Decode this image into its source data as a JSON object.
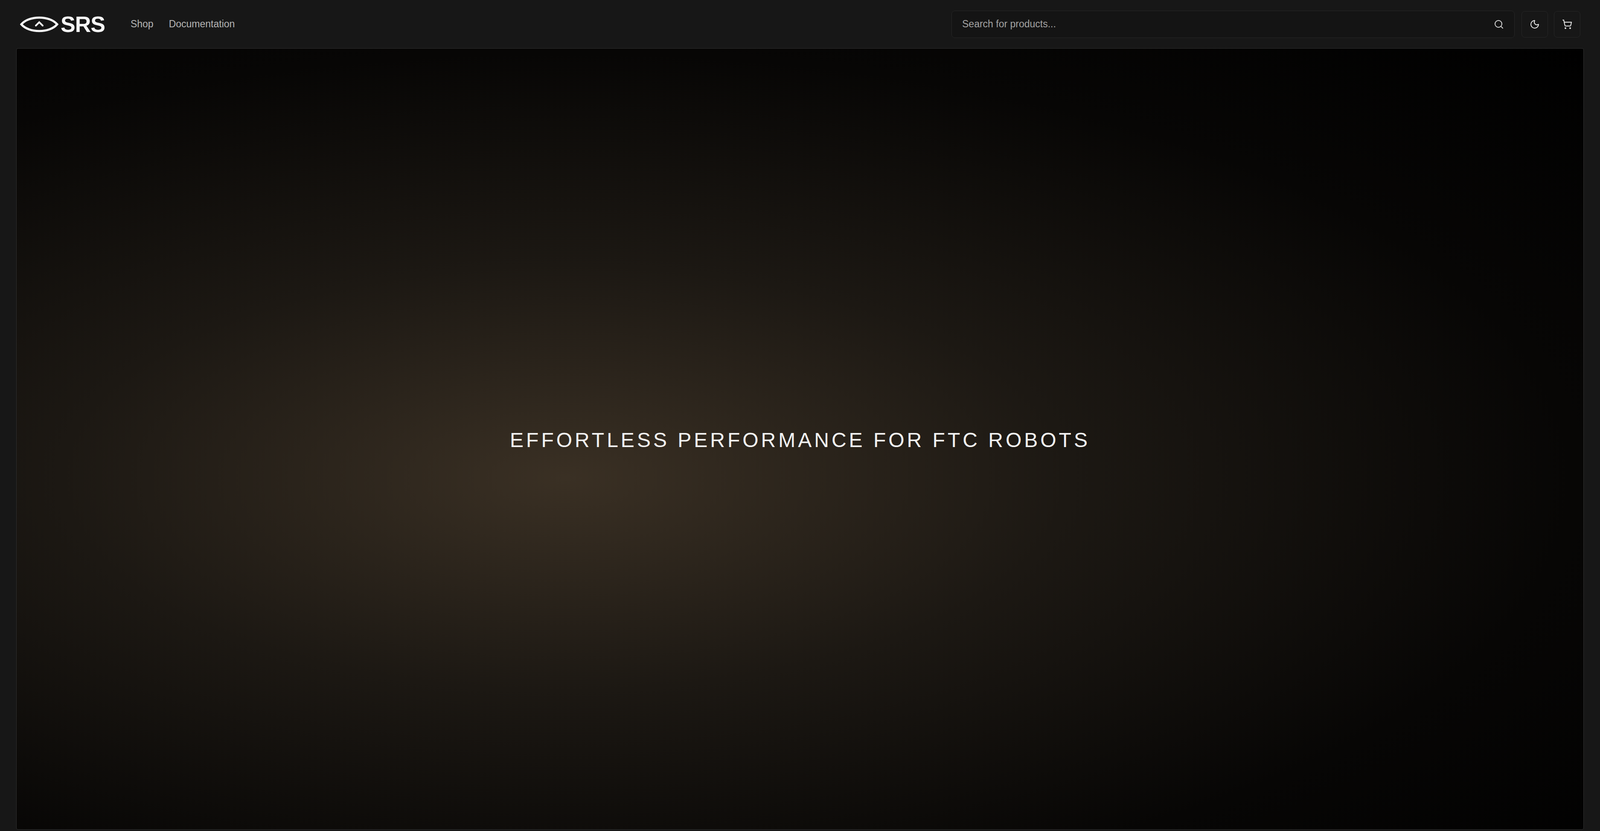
{
  "header": {
    "logo": "SRS",
    "nav": [
      {
        "label": "Shop"
      },
      {
        "label": "Documentation"
      }
    ],
    "search": {
      "placeholder": "Search for products..."
    }
  },
  "hero": {
    "headline": "EFFORTLESS PERFORMANCE FOR FTC ROBOTS"
  }
}
